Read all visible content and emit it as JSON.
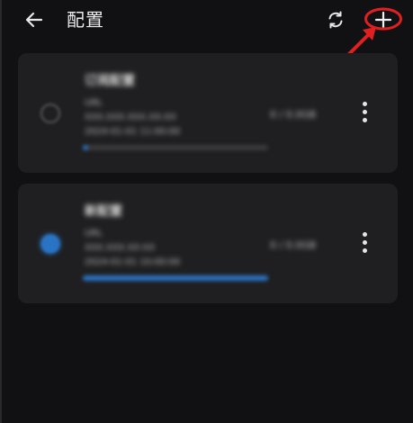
{
  "header": {
    "title": "配置",
    "back_icon": "arrow-left-icon",
    "refresh_icon": "refresh-icon",
    "add_icon": "plus-icon"
  },
  "annotation": {
    "color": "#e02020",
    "target": "add-button"
  },
  "colors": {
    "background": "#111113",
    "card": "#1f1f21",
    "accent": "#2a74c6"
  },
  "profiles": [
    {
      "name": "订阅配置",
      "type": "URL",
      "server": "XXX.XXX.XXX.XX:XX",
      "updated": "2024-01-01 11:00:00",
      "usage": "0 / 0.0GB",
      "selected": false,
      "progress": 0.03
    },
    {
      "name": "新配置",
      "type": "URL",
      "server": "XXX.XXX.XX:XX",
      "updated": "2024-01-01 10:00:00",
      "usage": "0 / 0.0GB",
      "selected": true,
      "progress": 1.0
    }
  ]
}
